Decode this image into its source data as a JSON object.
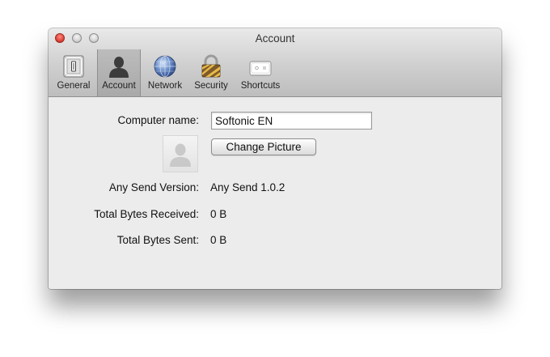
{
  "window": {
    "title": "Account"
  },
  "toolbar": {
    "items": [
      {
        "label": "General",
        "icon": "switch-icon",
        "selected": false
      },
      {
        "label": "Account",
        "icon": "user-silhouette-icon",
        "selected": true
      },
      {
        "label": "Network",
        "icon": "globe-icon",
        "selected": false
      },
      {
        "label": "Security",
        "icon": "padlock-icon",
        "selected": false
      },
      {
        "label": "Shortcuts",
        "icon": "keyboard-key-icon",
        "selected": false
      }
    ]
  },
  "account": {
    "computer_name_label": "Computer name:",
    "computer_name_value": "Softonic EN",
    "change_picture_label": "Change Picture",
    "version_label": "Any Send Version:",
    "version_value": "Any Send 1.0.2",
    "received_label": "Total Bytes Received:",
    "received_value": "0 B",
    "sent_label": "Total Bytes Sent:",
    "sent_value": "0 B"
  },
  "colors": {
    "window_bg": "#ececec",
    "close_button": "#e0443a",
    "toolbar_selected": "#b3b3b3"
  }
}
